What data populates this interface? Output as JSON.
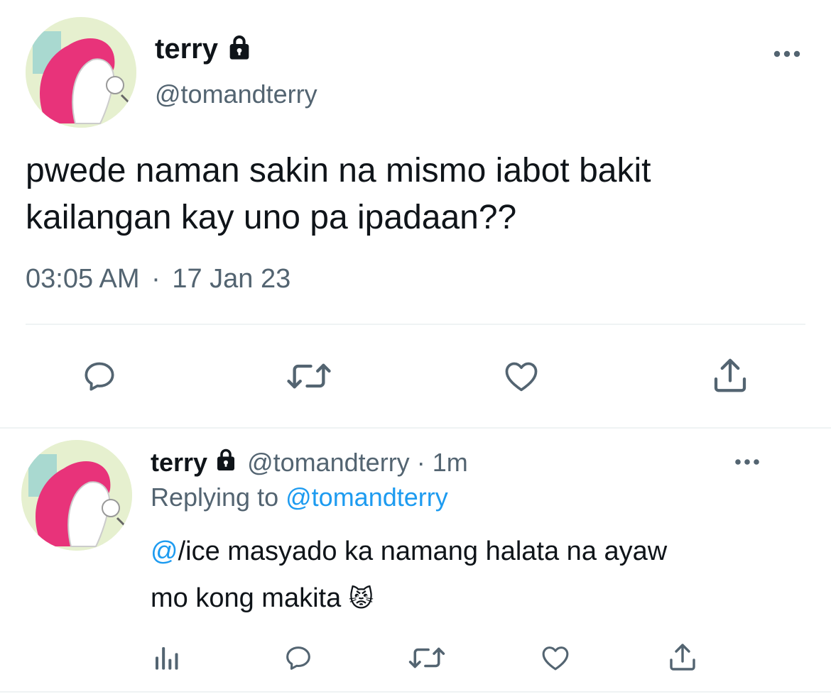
{
  "main_tweet": {
    "display_name": "terry",
    "handle": "@tomandterry",
    "text_line1": "pwede naman sakin na mismo iabot bakit",
    "text_line2": "kailangan kay uno pa ipadaan??",
    "time": "03:05 AM",
    "separator": "·",
    "date": "17 Jan 23",
    "icons": [
      "lock-icon",
      "more-icon",
      "reply-icon",
      "retweet-icon",
      "like-icon",
      "share-icon"
    ]
  },
  "reply": {
    "display_name": "terry",
    "handle": "@tomandterry",
    "separator": "·",
    "age": "1m",
    "replying_prefix": "Replying to",
    "replying_handle": "@tomandterry",
    "mention": "@",
    "text_rest_line1": "/ice masyado ka namang halata na ayaw",
    "text_line2": "mo kong makita",
    "emoji": "😾",
    "icons": [
      "lock-icon",
      "more-icon",
      "analytics-icon",
      "reply-icon",
      "retweet-icon",
      "like-icon",
      "share-icon"
    ]
  },
  "colors": {
    "text": "#0f1419",
    "secondary": "#536471",
    "link": "#1d9bf0",
    "divider": "#eff3f4"
  }
}
